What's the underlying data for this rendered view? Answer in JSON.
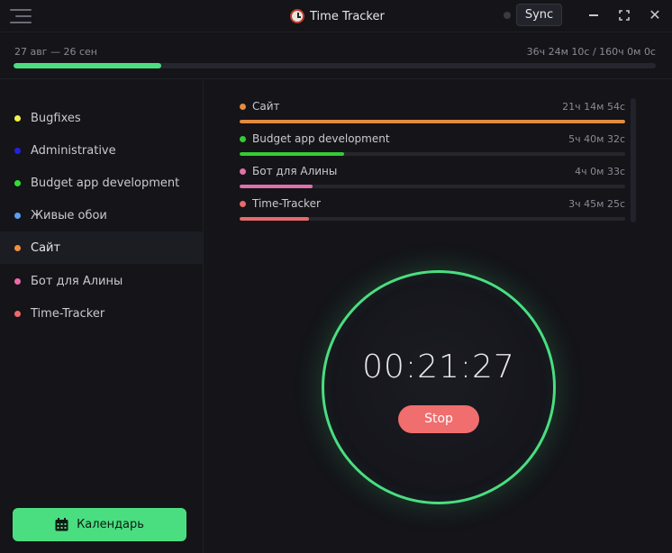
{
  "app": {
    "title": "Time Tracker",
    "icon": "alarm-clock-icon"
  },
  "header": {
    "sync_label": "Sync",
    "sync_status_color": "#3a3a42"
  },
  "period": {
    "range": "27 авг — 26 сен",
    "total": "36ч 24м 10с / 160ч 0м 0с",
    "progress_fraction": 0.23,
    "color": "#4ade80"
  },
  "sidebar": {
    "projects": [
      {
        "label": "Bugfixes",
        "color": "#f2f24a",
        "active": false
      },
      {
        "label": "Administrative",
        "color": "#2222dd",
        "active": false
      },
      {
        "label": "Budget app development",
        "color": "#33dd33",
        "active": false
      },
      {
        "label": "Живые обои",
        "color": "#5aa0ee",
        "active": false
      },
      {
        "label": "Сайт",
        "color": "#f0903c",
        "active": true
      },
      {
        "label": "Бот для Алины",
        "color": "#ee6aa8",
        "active": false
      },
      {
        "label": "Time-Tracker",
        "color": "#f06868",
        "active": false
      }
    ],
    "calendar_label": "Календарь"
  },
  "stats": [
    {
      "name": "Сайт",
      "time": "21ч 14м 54с",
      "color": "#e58a3f",
      "fraction": 1.0
    },
    {
      "name": "Budget app development",
      "time": "5ч 40м 32с",
      "color": "#33cc33",
      "fraction": 0.27
    },
    {
      "name": "Бот для Алины",
      "time": "4ч 0м 33с",
      "color": "#e070a8",
      "fraction": 0.19
    },
    {
      "name": "Time-Tracker",
      "time": "3ч 45м 25с",
      "color": "#e86a6a",
      "fraction": 0.18
    }
  ],
  "timer": {
    "display": "00:21:27",
    "stop_label": "Stop",
    "ring_color": "#4ade80"
  }
}
